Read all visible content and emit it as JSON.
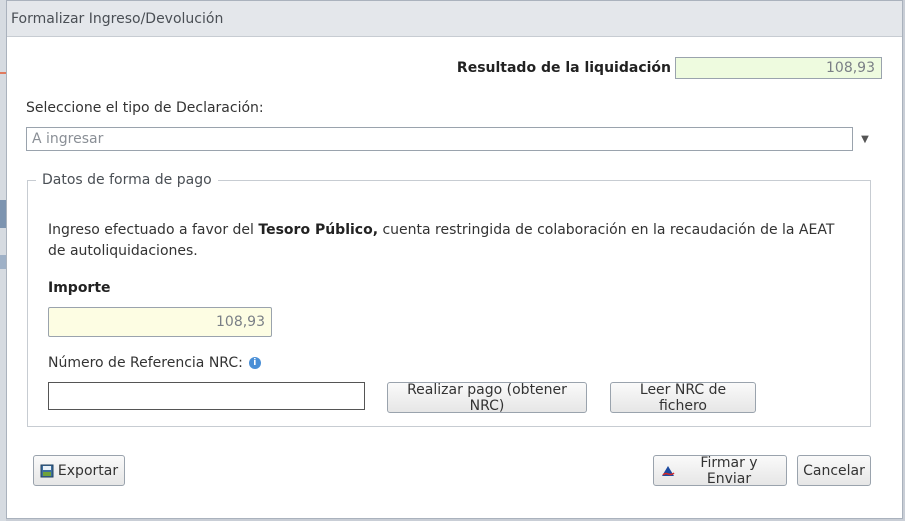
{
  "dialog": {
    "title": "Formalizar Ingreso/Devolución"
  },
  "resultado": {
    "label": "Resultado de la liquidación",
    "value": "108,93"
  },
  "declaracion": {
    "label": "Seleccione el tipo de Declaración:",
    "selected": "A ingresar"
  },
  "pago": {
    "legend": "Datos de forma de pago",
    "info_prefix": "Ingreso efectuado a favor del",
    "info_bold": "Tesoro Público,",
    "info_suffix": "cuenta restringida de colaboración en la recaudación de la AEAT de autoliquidaciones.",
    "importe_label": "Importe",
    "importe_value": "108,93",
    "nrc_label": "Número de Referencia  NRC:",
    "nrc_value": ""
  },
  "buttons": {
    "realizar": "Realizar pago (obtener NRC)",
    "leer": "Leer NRC de fichero",
    "exportar": "Exportar",
    "firmar": "Firmar y Enviar",
    "cancelar": "Cancelar"
  },
  "colors": {
    "result_bg": "#eefbdf",
    "importe_bg": "#fdfde3",
    "info_icon": "#4a8fd6"
  },
  "icons": {
    "exportar": "export-icon",
    "firmar": "signature-icon",
    "nrc_info": "info-icon",
    "select": "chevron-down-icon"
  }
}
